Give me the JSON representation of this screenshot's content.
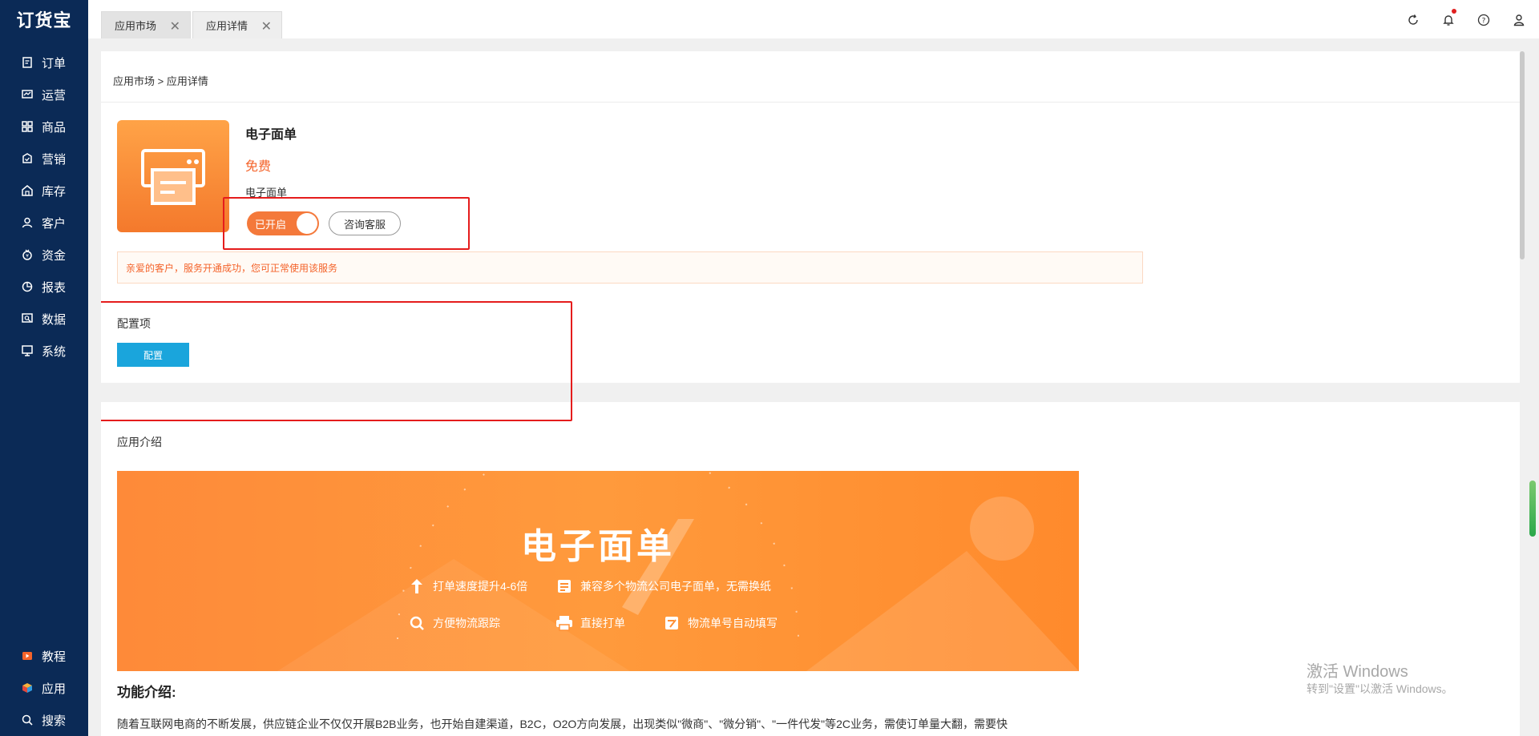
{
  "brand": {
    "logo": "订货宝"
  },
  "sidebar": {
    "items": [
      {
        "label": "订单",
        "icon": "order-icon"
      },
      {
        "label": "运营",
        "icon": "operation-icon"
      },
      {
        "label": "商品",
        "icon": "goods-icon"
      },
      {
        "label": "营销",
        "icon": "marketing-icon"
      },
      {
        "label": "库存",
        "icon": "inventory-icon"
      },
      {
        "label": "客户",
        "icon": "customer-icon"
      },
      {
        "label": "资金",
        "icon": "funds-icon"
      },
      {
        "label": "报表",
        "icon": "report-icon"
      },
      {
        "label": "数据",
        "icon": "data-icon"
      },
      {
        "label": "系统",
        "icon": "system-icon"
      }
    ],
    "bottom": [
      {
        "label": "教程",
        "icon": "tutorial-icon"
      },
      {
        "label": "应用",
        "icon": "apps-icon"
      },
      {
        "label": "搜索",
        "icon": "search-icon"
      }
    ]
  },
  "tabs": [
    {
      "label": "应用市场"
    },
    {
      "label": "应用详情"
    }
  ],
  "breadcrumb": "应用市场 > 应用详情",
  "app": {
    "name": "电子面单",
    "price": "免费",
    "subtitle": "电子面单",
    "toggle_label": "已开启",
    "consult_label": "咨询客服"
  },
  "notice": "亲爱的客户，服务开通成功，您可正常使用该服务",
  "config": {
    "title": "配置项",
    "button": "配置"
  },
  "intro": {
    "title": "应用介绍",
    "banner_title": "电子面单",
    "features": [
      "打单速度提升4-6倍",
      "兼容多个物流公司电子面单，无需换纸",
      "方便物流跟踪",
      "直接打单",
      "物流单号自动填写"
    ]
  },
  "function": {
    "title": "功能介绍:",
    "text": "随着互联网电商的不断发展，供应链企业不仅仅开展B2B业务，也开始自建渠道，B2C，O2O方向发展，出现类似\"微商\"、\"微分销\"、\"一件代发\"等2C业务，需使订单量大翻，需要快"
  },
  "watermark": {
    "line1": "激活 Windows",
    "line2": "转到\"设置\"以激活 Windows。"
  },
  "colors": {
    "sidebar_bg": "#0b2a56",
    "accent_orange": "#f4793b",
    "config_button": "#1aa5dc",
    "highlight_red": "#e51c1c"
  }
}
